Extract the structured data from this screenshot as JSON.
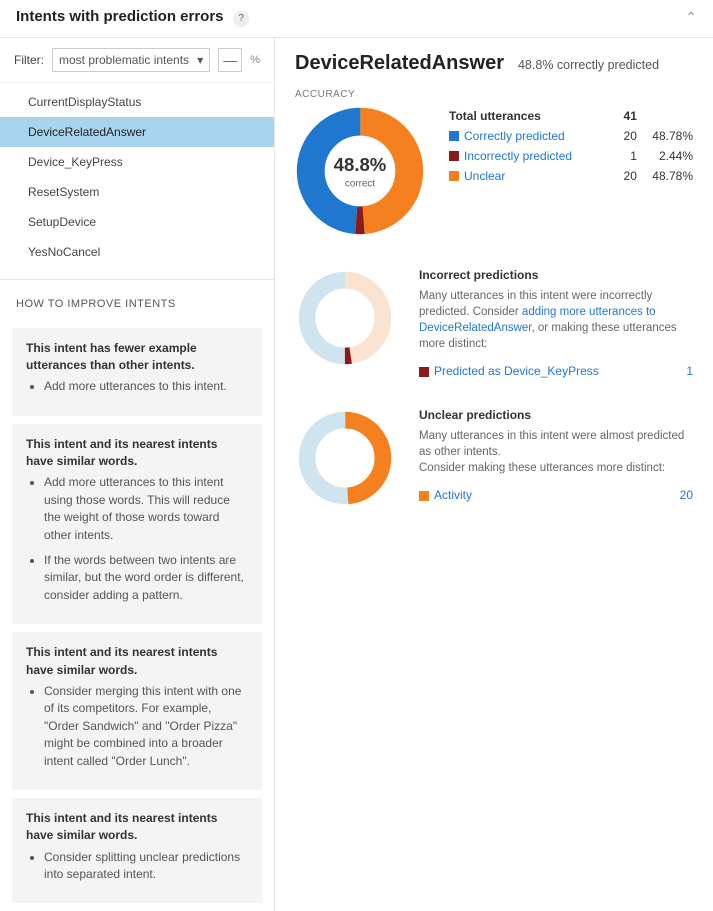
{
  "header": {
    "title": "Intents with prediction errors",
    "help": "?",
    "collapse_glyph": "⌃"
  },
  "filter": {
    "label": "Filter:",
    "dropdown_value": "most problematic intents",
    "dash": "—",
    "pct": "%"
  },
  "intents": [
    {
      "name": "CurrentDisplayStatus",
      "selected": false
    },
    {
      "name": "DeviceRelatedAnswer",
      "selected": true
    },
    {
      "name": "Device_KeyPress",
      "selected": false
    },
    {
      "name": "ResetSystem",
      "selected": false
    },
    {
      "name": "SetupDevice",
      "selected": false
    },
    {
      "name": "YesNoCancel",
      "selected": false
    }
  ],
  "how_to": {
    "title": "HOW TO IMPROVE INTENTS",
    "cards": [
      {
        "heading": "This intent has fewer example utterances than other intents.",
        "bullets": [
          "Add more utterances to this intent."
        ]
      },
      {
        "heading": "This intent and its nearest intents have similar words.",
        "bullets": [
          "Add more utterances to this intent using those words. This will reduce the weight of those words toward other intents.",
          "If the words between two intents are similar, but the word order is different, consider adding a pattern."
        ]
      },
      {
        "heading": "This intent and its nearest intents have similar words.",
        "bullets": [
          "Consider merging this intent with one of its competitors. For example, \"Order Sandwich\" and \"Order Pizza\" might be combined into a broader intent called \"Order Lunch\"."
        ]
      },
      {
        "heading": "This intent and its nearest intents have similar words.",
        "bullets": [
          "Consider splitting unclear predictions into separated intent."
        ]
      }
    ]
  },
  "detail": {
    "title": "DeviceRelatedAnswer",
    "subtitle": "48.8% correctly predicted",
    "accuracy_label": "ACCURACY",
    "donut_center": "48.8%",
    "donut_center_sub": "correct",
    "total_label": "Total utterances",
    "total_value": "41",
    "rows": [
      {
        "color": "blue",
        "label": "Correctly predicted",
        "count": "20",
        "pct": "48.78%"
      },
      {
        "color": "darkred",
        "label": "Incorrectly predicted",
        "count": "1",
        "pct": "2.44%"
      },
      {
        "color": "orange",
        "label": "Unclear",
        "count": "20",
        "pct": "48.78%"
      }
    ],
    "incorrect": {
      "title": "Incorrect predictions",
      "text1": "Many utterances in this intent were incorrectly predicted. Consider ",
      "link1": "adding more utterances to DeviceRelatedAnswer",
      "text2": ", or making these utterances more distinct:",
      "items": [
        {
          "color": "darkred",
          "label": "Predicted as Device_KeyPress",
          "count": "1"
        }
      ]
    },
    "unclear": {
      "title": "Unclear predictions",
      "text": "Many utterances in this intent were almost predicted as other intents.\nConsider making these utterances more distinct:",
      "items": [
        {
          "color": "orange",
          "label": "Activity",
          "count": "20"
        }
      ]
    }
  },
  "chart_data": [
    {
      "type": "pie",
      "title": "Accuracy",
      "series": [
        {
          "name": "Correctly predicted",
          "value": 20,
          "pct": 48.78,
          "color": "#1f77d0"
        },
        {
          "name": "Incorrectly predicted",
          "value": 1,
          "pct": 2.44,
          "color": "#8b1a1a"
        },
        {
          "name": "Unclear",
          "value": 20,
          "pct": 48.78,
          "color": "#f58020"
        }
      ],
      "total": 41,
      "center_label": "48.8% correct"
    },
    {
      "type": "pie",
      "title": "Incorrect predictions",
      "series": [
        {
          "name": "Predicted as Device_KeyPress",
          "value": 1,
          "pct": 2.44,
          "color": "#8b1a1a"
        },
        {
          "name": "Other",
          "value": 40,
          "pct": 97.56,
          "color": "#cfe4ef"
        }
      ]
    },
    {
      "type": "pie",
      "title": "Unclear predictions",
      "series": [
        {
          "name": "Activity",
          "value": 20,
          "pct": 48.78,
          "color": "#f58020"
        },
        {
          "name": "Other",
          "value": 21,
          "pct": 51.22,
          "color": "#cfe4ef"
        }
      ]
    }
  ]
}
